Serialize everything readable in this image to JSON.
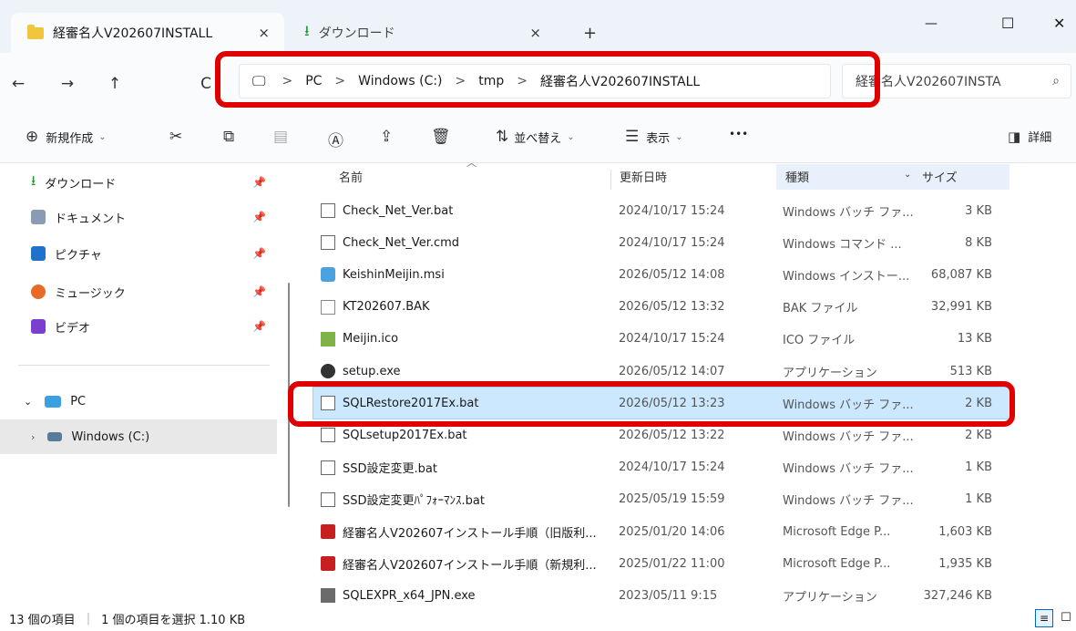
{
  "tabs": [
    {
      "label": "経審名人V202607INSTALL",
      "close": "×"
    },
    {
      "label": "ダウンロード",
      "close": "×"
    }
  ],
  "new_tab": "+",
  "window_controls": {
    "minimize": "—",
    "maximize": "☐",
    "close": "✕"
  },
  "nav": {
    "back": "←",
    "forward": "→",
    "up": "↑",
    "refresh": "C"
  },
  "breadcrumb": [
    "PC",
    "Windows (C:)",
    "tmp",
    "経審名人V202607INSTALL"
  ],
  "breadcrumb_sep": ">",
  "search_text": "経審名人V202607INSTA",
  "toolbar": {
    "new": "新規作成",
    "sort": "並べ替え",
    "view": "表示",
    "more": "•••",
    "details": "詳細"
  },
  "sidebar": {
    "quick": [
      {
        "label": "ダウンロード"
      },
      {
        "label": "ドキュメント"
      },
      {
        "label": "ピクチャ"
      },
      {
        "label": "ミュージック"
      },
      {
        "label": "ビデオ"
      }
    ],
    "pc": "PC",
    "drive": "Windows (C:)"
  },
  "columns": {
    "name": "名前",
    "date": "更新日時",
    "type": "種類",
    "size": "サイズ"
  },
  "files": [
    {
      "name": "Check_Net_Ver.bat",
      "date": "2024/10/17 15:24",
      "type": "Windows バッチ ファ...",
      "size": "3 KB",
      "icon": "bat"
    },
    {
      "name": "Check_Net_Ver.cmd",
      "date": "2024/10/17 15:24",
      "type": "Windows コマンド ...",
      "size": "8 KB",
      "icon": "bat"
    },
    {
      "name": "KeishinMeijin.msi",
      "date": "2026/05/12 14:08",
      "type": "Windows インストー...",
      "size": "68,087 KB",
      "icon": "msi"
    },
    {
      "name": "KT202607.BAK",
      "date": "2026/05/12 13:32",
      "type": "BAK ファイル",
      "size": "32,991 KB",
      "icon": "bak"
    },
    {
      "name": "Meijin.ico",
      "date": "2024/10/17 15:24",
      "type": "ICO ファイル",
      "size": "13 KB",
      "icon": "ico"
    },
    {
      "name": "setup.exe",
      "date": "2026/05/12 14:07",
      "type": "アプリケーション",
      "size": "513 KB",
      "icon": "exe"
    },
    {
      "name": "SQLRestore2017Ex.bat",
      "date": "2026/05/12 13:23",
      "type": "Windows バッチ ファ...",
      "size": "2 KB",
      "icon": "bat"
    },
    {
      "name": "SQLsetup2017Ex.bat",
      "date": "2026/05/12 13:22",
      "type": "Windows バッチ ファ...",
      "size": "2 KB",
      "icon": "bat"
    },
    {
      "name": "SSD設定変更.bat",
      "date": "2024/10/17 15:24",
      "type": "Windows バッチ ファ...",
      "size": "1 KB",
      "icon": "bat"
    },
    {
      "name": "SSD設定変更ﾊﾟﾌｫｰﾏﾝｽ.bat",
      "date": "2025/05/19 15:59",
      "type": "Windows バッチ ファ...",
      "size": "1 KB",
      "icon": "bat"
    },
    {
      "name": "経審名人V202607インストール手順（旧版利...",
      "date": "2025/01/20 14:06",
      "type": "Microsoft Edge P...",
      "size": "1,603 KB",
      "icon": "pdf"
    },
    {
      "name": "経審名人V202607インストール手順（新規利...",
      "date": "2025/01/22 11:00",
      "type": "Microsoft Edge P...",
      "size": "1,935 KB",
      "icon": "pdf"
    },
    {
      "name": "SQLEXPR_x64_JPN.exe",
      "date": "2023/05/11 9:15",
      "type": "アプリケーション",
      "size": "327,246 KB",
      "icon": "sql"
    }
  ],
  "selected_index": 6,
  "status": {
    "count": "13 個の項目",
    "selected": "1 個の項目を選択  1.10 KB"
  },
  "colors": {
    "accent": "#0067c0",
    "selection": "#cce8ff",
    "highlight": "#e00000"
  }
}
